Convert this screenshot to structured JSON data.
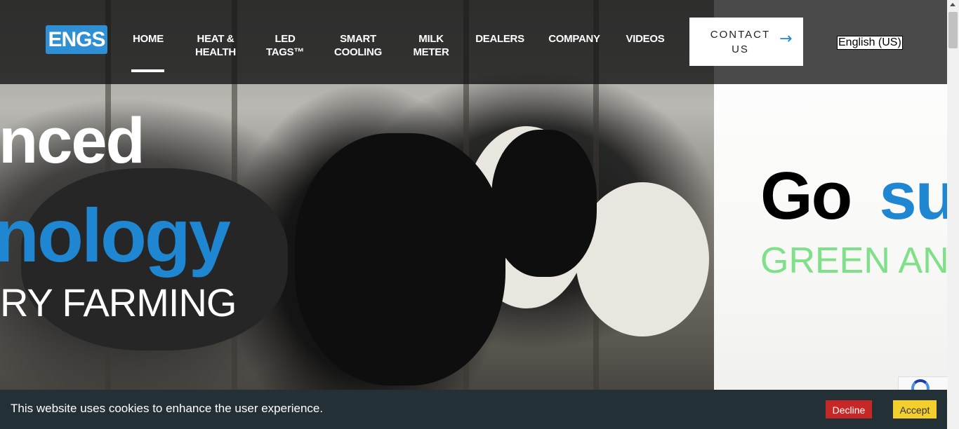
{
  "logo": {
    "text": "ENGS"
  },
  "nav": {
    "items": [
      {
        "line1": "HOME",
        "line2": ""
      },
      {
        "line1": "HEAT &",
        "line2": "HEALTH"
      },
      {
        "line1": "LED",
        "line2": "TAGS™"
      },
      {
        "line1": "SMART",
        "line2": "COOLING"
      },
      {
        "line1": "MILK",
        "line2": "METER"
      },
      {
        "line1": "DEALERS",
        "line2": ""
      },
      {
        "line1": "COMPANY",
        "line2": ""
      },
      {
        "line1": "VIDEOS",
        "line2": ""
      }
    ],
    "active": "HOME",
    "contact": {
      "line1": "CONTACT",
      "line2": "US",
      "arrow": "→"
    },
    "language": "English (US)"
  },
  "hero": {
    "slide1": {
      "line1": "nced",
      "line2": "nology",
      "line3": "RY FARMING"
    },
    "slide2": {
      "word1": "Go",
      "word2": "su",
      "line2": "GREEN AN"
    }
  },
  "cookie": {
    "message": "This website uses cookies to enhance the user experience.",
    "decline_label": "Decline",
    "accept_label": "Accept"
  },
  "colors": {
    "brand_blue": "#1f86d1",
    "green": "#7fe08a",
    "decline_red": "#c62828",
    "accept_yellow": "#f2cf2c"
  },
  "icons": {
    "contact_arrow": "arrow-right-icon",
    "recaptcha": "recaptcha-icon"
  }
}
